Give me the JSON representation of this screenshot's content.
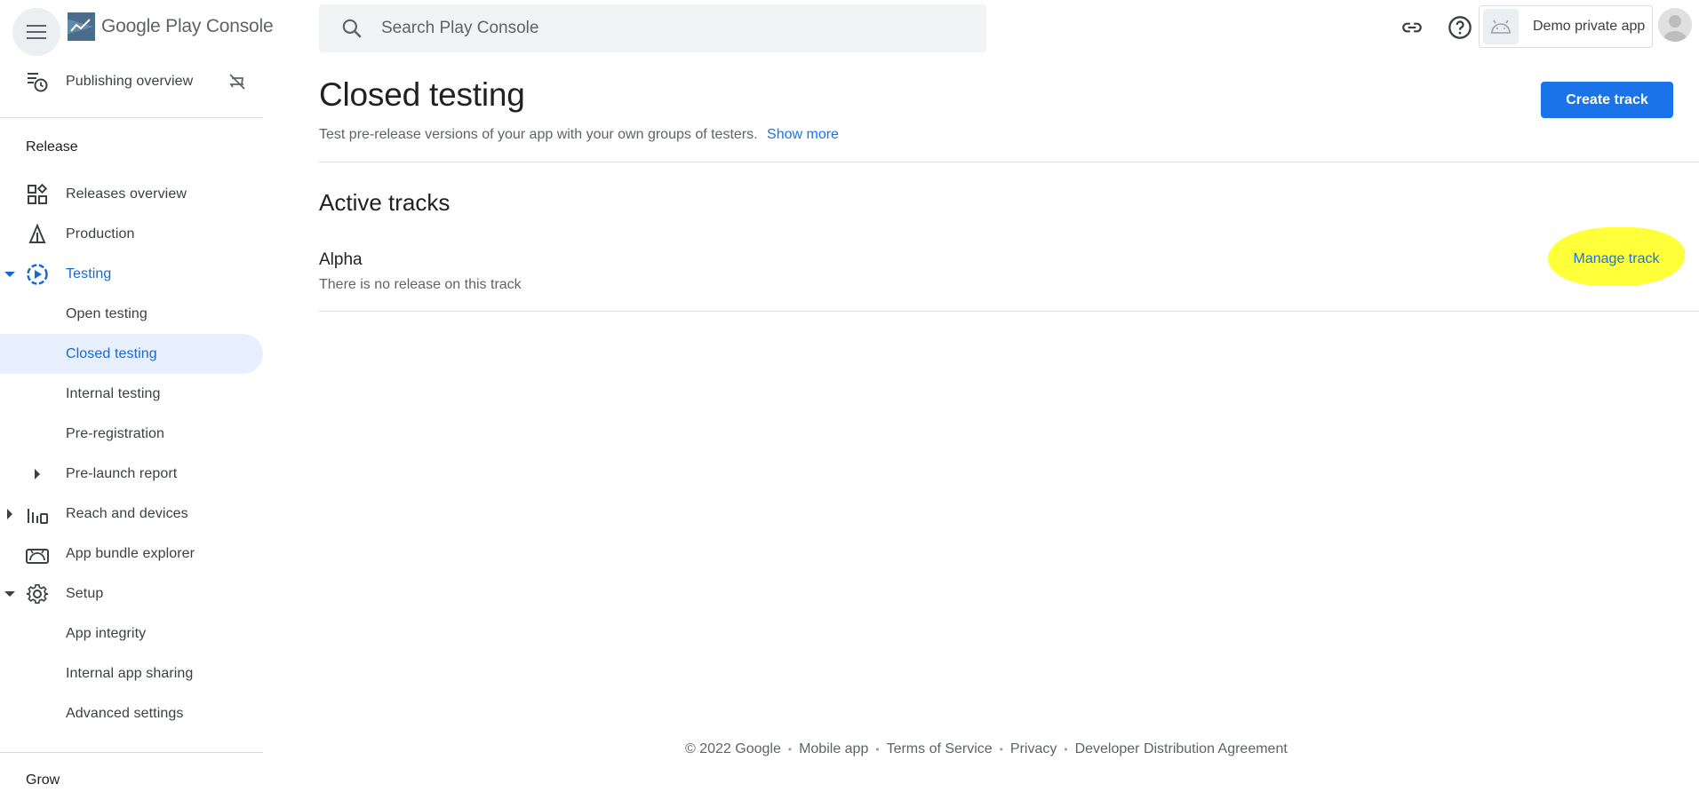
{
  "header": {
    "logo_text": "Google Play Console",
    "search_placeholder": "Search Play Console",
    "app_name": "Demo private app"
  },
  "sidebar": {
    "publishing_overview": "Publishing overview",
    "release_section": "Release",
    "items": {
      "releases_overview": "Releases overview",
      "production": "Production",
      "testing": "Testing",
      "open_testing": "Open testing",
      "closed_testing": "Closed testing",
      "internal_testing": "Internal testing",
      "pre_registration": "Pre-registration",
      "pre_launch_report": "Pre-launch report",
      "reach_and_devices": "Reach and devices",
      "app_bundle_explorer": "App bundle explorer",
      "setup": "Setup",
      "app_integrity": "App integrity",
      "internal_app_sharing": "Internal app sharing",
      "advanced_settings": "Advanced settings"
    },
    "grow_section": "Grow"
  },
  "main": {
    "title": "Closed testing",
    "description": "Test pre-release versions of your app with your own groups of testers.",
    "show_more": "Show more",
    "create_track": "Create track",
    "active_tracks_title": "Active tracks",
    "tracks": [
      {
        "name": "Alpha",
        "status": "There is no release on this track",
        "action": "Manage track"
      }
    ]
  },
  "footer": {
    "links": [
      "© 2022 Google",
      "Mobile app",
      "Terms of Service",
      "Privacy",
      "Developer Distribution Agreement"
    ]
  },
  "colors": {
    "accent": "#1a73e8",
    "active_bg": "#e8f0fe",
    "highlight": "#ffff3a"
  },
  "icons": [
    "menu-icon",
    "play-console-logo-icon",
    "search-icon",
    "link-icon",
    "help-icon",
    "android-icon",
    "avatar-icon",
    "publishing-overview-icon",
    "managed-publishing-off-icon",
    "releases-overview-icon",
    "production-icon",
    "testing-icon",
    "reach-devices-icon",
    "app-bundle-icon",
    "setup-gear-icon"
  ]
}
